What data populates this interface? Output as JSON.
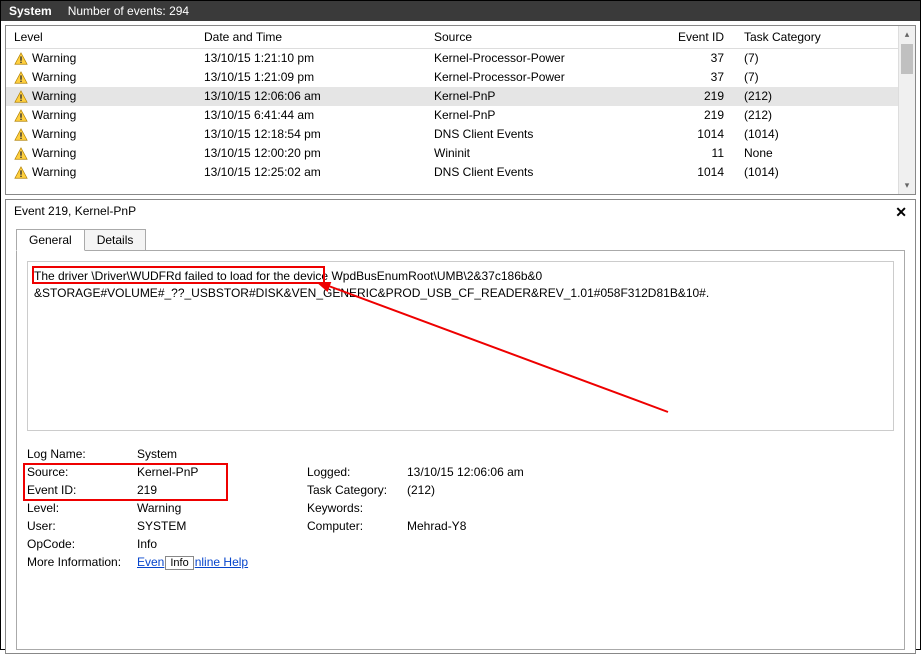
{
  "titlebar": {
    "title": "System",
    "count_label": "Number of events: 294"
  },
  "columns": {
    "level": "Level",
    "date": "Date and Time",
    "source": "Source",
    "evid": "Event ID",
    "task": "Task Category"
  },
  "rows": [
    {
      "level": "Warning",
      "date": "13/10/15 1:21:10 pm",
      "source": "Kernel-Processor-Power",
      "evid": "37",
      "task": "(7)",
      "selected": false
    },
    {
      "level": "Warning",
      "date": "13/10/15 1:21:09 pm",
      "source": "Kernel-Processor-Power",
      "evid": "37",
      "task": "(7)",
      "selected": false
    },
    {
      "level": "Warning",
      "date": "13/10/15 12:06:06 am",
      "source": "Kernel-PnP",
      "evid": "219",
      "task": "(212)",
      "selected": true
    },
    {
      "level": "Warning",
      "date": "13/10/15 6:41:44 am",
      "source": "Kernel-PnP",
      "evid": "219",
      "task": "(212)",
      "selected": false
    },
    {
      "level": "Warning",
      "date": "13/10/15 12:18:54 pm",
      "source": "DNS Client Events",
      "evid": "1014",
      "task": "(1014)",
      "selected": false
    },
    {
      "level": "Warning",
      "date": "13/10/15 12:00:20 pm",
      "source": "Wininit",
      "evid": "11",
      "task": "None",
      "selected": false
    },
    {
      "level": "Warning",
      "date": "13/10/15 12:25:02 am",
      "source": "DNS Client Events",
      "evid": "1014",
      "task": "(1014)",
      "selected": false
    }
  ],
  "detail_header": "Event 219, Kernel-PnP",
  "tabs": {
    "general": "General",
    "details": "Details"
  },
  "description": {
    "part1": "The driver \\Driver\\WUDFRd failed to load for the device ",
    "part2": "WpdBusEnumRoot\\UMB\\2&37c186b&0",
    "line2": "&STORAGE#VOLUME#_??_USBSTOR#DISK&VEN_GENERIC&PROD_USB_CF_READER&REV_1.01#058F312D81B&10#."
  },
  "props": {
    "logname_l": "Log Name:",
    "logname_v": "System",
    "source_l": "Source:",
    "source_v": "Kernel-PnP",
    "logged_l": "Logged:",
    "logged_v": "13/10/15 12:06:06 am",
    "evid_l": "Event ID:",
    "evid_v": "219",
    "taskcat_l": "Task Category:",
    "taskcat_v": "(212)",
    "level_l": "Level:",
    "level_v": "Warning",
    "keywords_l": "Keywords:",
    "keywords_v": "",
    "user_l": "User:",
    "user_v": "SYSTEM",
    "computer_l": "Computer:",
    "computer_v": "Mehrad-Y8",
    "opcode_l": "OpCode:",
    "opcode_v": "Info",
    "more_l": "More Information:",
    "link1": "Even",
    "tooltip": "Info",
    "link2": "nline Help"
  }
}
